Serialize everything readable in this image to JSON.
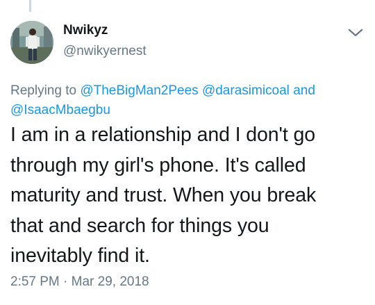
{
  "tweet": {
    "author": {
      "display_name": "Nwikyz",
      "handle": "@nwikyernest",
      "avatar_icon": "person-photo-avatar"
    },
    "reply_context": {
      "prefix": "Replying to",
      "mentions": [
        "@TheBigMan2Pees",
        "@darasimicoal",
        "@IsaacMbaegbu"
      ],
      "conjunction": "and"
    },
    "text": "I am in a relationship and I don't go\nthrough my girl's phone. It's called\nmaturity and trust.  When you break\nthat and search for things you\ninevitably find it.",
    "time": "2:57 PM",
    "separator": "·",
    "date": "Mar 29, 2018",
    "menu_icon": "chevron-down-icon"
  },
  "colors": {
    "text": "#14171a",
    "secondary": "#657786",
    "link": "#1b95e0",
    "thread_line": "#ccd6dd"
  }
}
